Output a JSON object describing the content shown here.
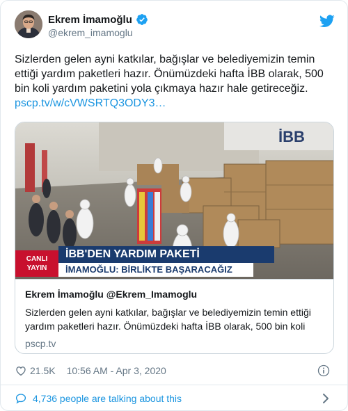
{
  "author": {
    "display_name": "Ekrem İmamoğlu",
    "handle": "@ekrem_imamoglu",
    "verified": true
  },
  "tweet": {
    "text": "Sizlerden gelen ayni katkılar, bağışlar ve belediyemizin temin ettiği yardım paketleri hazır. Önümüzdeki hafta İBB olarak, 500 bin koli yardım paketini yola çıkmaya hazır hale getireceğiz.",
    "link_text": "pscp.tv/w/cVWSRTQ3ODY3…"
  },
  "card": {
    "media_overlay": {
      "live_label_line1": "CANLI",
      "live_label_line2": "YAYIN",
      "headline": "İBB'DEN YARDIM PAKETİ",
      "subline": "İMAMOĞLU: BİRLİKTE BAŞARACAĞIZ",
      "wall_logo": "İBB"
    },
    "title": "Ekrem İmamoğlu @Ekrem_Imamoglu",
    "description": "Sizlerden gelen ayni katkılar, bağışlar ve belediyemizin temin ettiği yardım paketleri hazır. Önümüzdeki hafta İBB olarak, 500 bin koli",
    "domain": "pscp.tv"
  },
  "meta": {
    "like_count": "21.5K",
    "timestamp": "10:56 AM - Apr 3, 2020"
  },
  "footer": {
    "talking_text": "4,736 people are talking about this"
  },
  "icons": {
    "verified": "verified-badge-icon",
    "brand": "twitter-bird-icon",
    "like": "heart-icon",
    "info": "info-icon",
    "conversation": "speech-bubble-icon",
    "more": "chevron-right-icon"
  },
  "colors": {
    "twitter_blue": "#1da1f2",
    "link_blue": "#1b95e0",
    "muted_text": "#657786",
    "border": "#ccd6dd",
    "live_red": "#c8102e",
    "banner_navy": "#1a3b6e"
  }
}
